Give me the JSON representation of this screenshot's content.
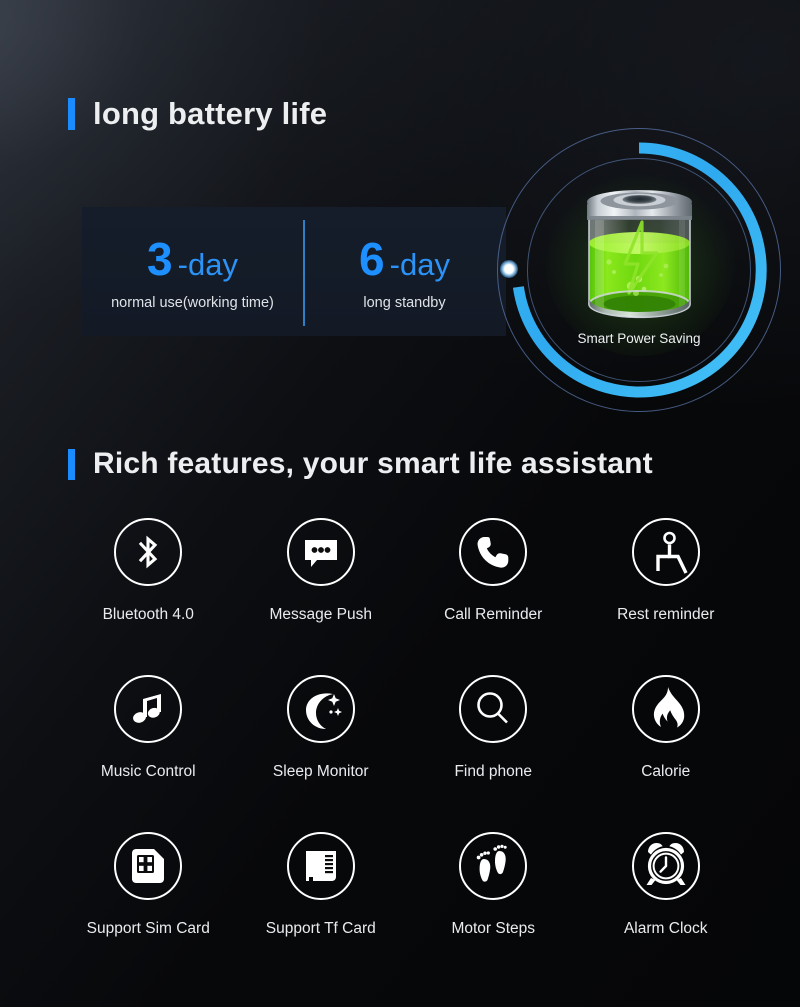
{
  "page": {
    "background_start": "#2a2e36",
    "background_end": "#050607",
    "accent_blue": "#1a8cff"
  },
  "battery_section": {
    "heading": "long battery life",
    "stats": [
      {
        "number": "3",
        "unit": "-day",
        "description": "normal use(working time)"
      },
      {
        "number": "6",
        "unit": "-day",
        "description": "long standby"
      }
    ],
    "graphic": {
      "label": "Smart Power Saving",
      "battery_icon": "battery-charging-icon",
      "ring_color": "#33b1f0",
      "battery_fill_color": "#6fd80f"
    }
  },
  "features_section": {
    "heading": "Rich features, your smart life assistant",
    "items": [
      {
        "label": "Bluetooth 4.0",
        "icon": "bluetooth-icon"
      },
      {
        "label": "Message Push",
        "icon": "message-bubble-icon"
      },
      {
        "label": "Call Reminder",
        "icon": "phone-handset-icon"
      },
      {
        "label": "Rest reminder",
        "icon": "seated-person-icon"
      },
      {
        "label": "Music Control",
        "icon": "music-note-icon"
      },
      {
        "label": "Sleep Monitor",
        "icon": "crescent-moon-stars-icon"
      },
      {
        "label": "Find phone",
        "icon": "magnifying-glass-icon"
      },
      {
        "label": "Calorie",
        "icon": "flame-icon"
      },
      {
        "label": "Support Sim Card",
        "icon": "sim-card-icon"
      },
      {
        "label": "Support Tf Card",
        "icon": "tf-card-icon"
      },
      {
        "label": "Motor Steps",
        "icon": "footprints-icon"
      },
      {
        "label": "Alarm Clock",
        "icon": "alarm-clock-icon"
      }
    ]
  }
}
